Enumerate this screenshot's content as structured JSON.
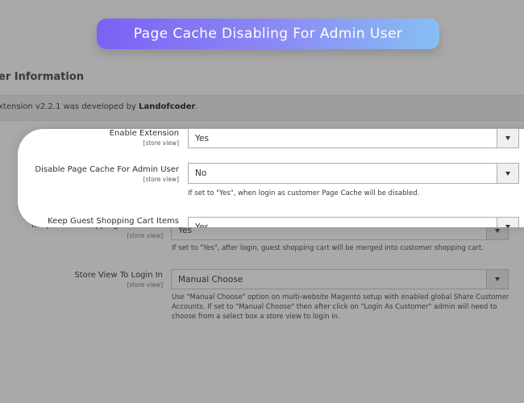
{
  "banner": {
    "title": "Page Cache Disabling For Admin User"
  },
  "section": {
    "title": "er Information"
  },
  "info": {
    "prefix": "xtension v2.2.1 was developed by ",
    "vendor": "Landofcoder",
    "suffix": "."
  },
  "fields": {
    "enable_extension": {
      "label": "Enable Extension",
      "scope": "[store view]",
      "value": "Yes"
    },
    "disable_page_cache": {
      "label": "Disable Page Cache For Admin User",
      "scope": "[store view]",
      "value": "No",
      "note": "If set to \"Yes\", when login as customer Page Cache will be disabled."
    },
    "keep_guest_cart": {
      "label": "Keep Guest Shopping Cart Items",
      "scope": "[store view]",
      "value": "Yes",
      "note": "If set to \"Yes\", after login, guest shopping cart will be merged into customer shopping cart."
    },
    "store_view_login": {
      "label": "Store View To Login In",
      "scope": "[store view]",
      "value": "Manual Choose",
      "note": "Use \"Manual Choose\" option on multi-website Magento setup with enabled global Share Customer Accounts. If set to \"Manual Choose\" then after click on \"Login As Customer\" admin will need to choose from a select box a store view to login in."
    }
  }
}
